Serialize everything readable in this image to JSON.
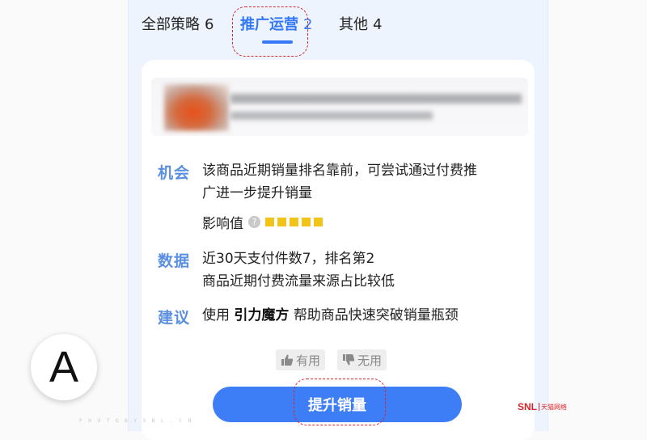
{
  "tabs": [
    {
      "label": "全部策略",
      "count": "6",
      "active": false
    },
    {
      "label": "推广运营",
      "count": "2",
      "active": true
    },
    {
      "label": "其他",
      "count": "4",
      "active": false
    }
  ],
  "opportunity": {
    "title": "机会",
    "line1": "该商品近期销量排名靠前，可尝试通过付费推",
    "line2": "广进一步提升销量",
    "impact_label": "影响值",
    "impact_level": 5,
    "impact_max": 5
  },
  "data_section": {
    "title": "数据",
    "line1": "近30天支付件数7，排名第2",
    "line2": "商品近期付费流量来源占比较低"
  },
  "suggestion": {
    "title": "建议",
    "prefix": "使用",
    "tool": "引力魔方",
    "suffix": "帮助商品快速突破销量瓶颈"
  },
  "feedback": {
    "useful": "有用",
    "useless": "无用"
  },
  "cta_label": "提升销量",
  "badge_letter": "A",
  "watermark": "P H O T O   B Y   S N L . C N",
  "logo": {
    "brand": "SNL",
    "sub": "天猫网络"
  },
  "colors": {
    "accent": "#3478f6",
    "section_title": "#5b8fe0",
    "star": "#f0c419",
    "annotation": "#d8262c"
  }
}
